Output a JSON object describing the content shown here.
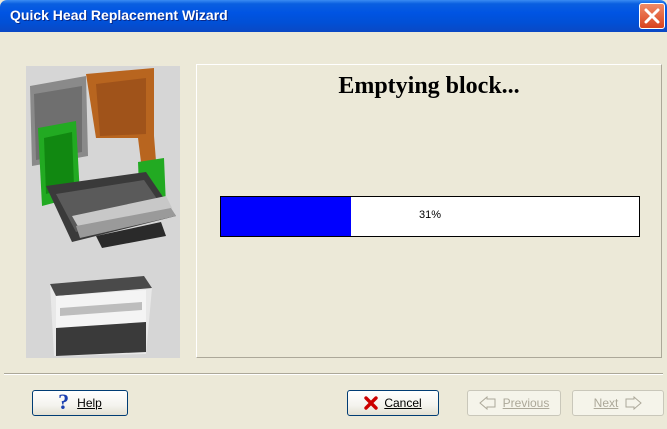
{
  "window": {
    "title": "Quick Head Replacement Wizard"
  },
  "icons": {
    "close": "close-icon",
    "help": "help-icon",
    "cancel": "cancel-x-icon",
    "previous": "arrow-left-icon",
    "next": "arrow-right-icon"
  },
  "content": {
    "heading": "Emptying block..."
  },
  "progress": {
    "value": 0.31,
    "text": "31%",
    "fill_color": "#0000ff"
  },
  "buttons": {
    "help": "Help",
    "cancel": "Cancel",
    "previous": "Previous",
    "next": "Next"
  },
  "colors": {
    "titlebar": "#0054e3",
    "close": "#d9421e",
    "progress_fill": "#0000ff"
  }
}
